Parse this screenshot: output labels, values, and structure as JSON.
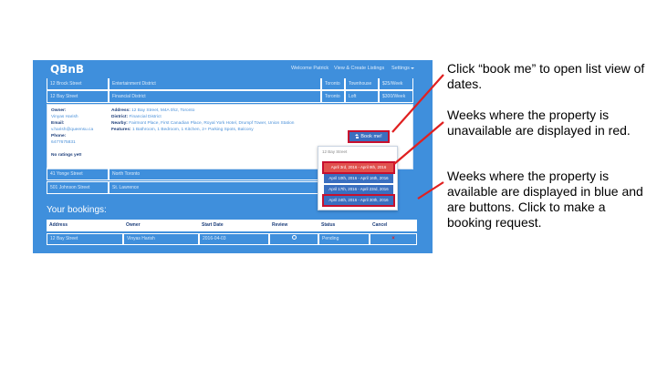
{
  "app": {
    "logo": "QBnB",
    "nav": {
      "welcome": "Welcome Patrick",
      "view_create": "View & Create Listings",
      "settings": "Settings"
    },
    "listings_top": [
      {
        "address": "12 Brock Street",
        "district": "Entertainment District",
        "city": "Toronto",
        "type": "Townhouse",
        "price": "$25/Week"
      },
      {
        "address": "12 Bay Street",
        "district": "Financial District",
        "city": "Toronto",
        "type": "Loft",
        "price": "$300/Week"
      }
    ],
    "detail": {
      "owner_label": "Owner:",
      "owner": "Vinyas Harish",
      "email_label": "Email:",
      "email": "v.harish@queensu.ca",
      "phone_label": "Phone:",
      "phone": "6477675831",
      "ratings": "No ratings yet!",
      "address_label": "Address:",
      "address": "12 Bay Street, M4A 0h2, Toronto",
      "district_label": "District:",
      "district": "Financial District",
      "nearby_label": "Nearby:",
      "nearby": "Fairmont Place, First Canadian Place, Royal York Hotel, Drumpf Tower, Union Station",
      "features_label": "Features:",
      "features": "1 Bathroom, 1 Bedroom, 1 Kitchen, 2+ Parking Spots, Balcony",
      "book_button": "Book me!"
    },
    "dropdown": {
      "title": "12 Bay Street",
      "weeks": [
        {
          "label": "April 3rd, 2016 - April 9th, 2016",
          "status": "unavailable"
        },
        {
          "label": "April 10th, 2016 - April 16th, 2016",
          "status": "available"
        },
        {
          "label": "April 17th, 2016 - April 23rd, 2016",
          "status": "available"
        },
        {
          "label": "April 24th, 2016 - April 30th, 2016",
          "status": "available"
        }
      ]
    },
    "listings_bottom": [
      {
        "address": "41 Yonge Street",
        "district": "North Toronto"
      },
      {
        "address": "501 Johnson Street",
        "district": "St. Lawrence"
      }
    ],
    "bookings": {
      "title": "Your bookings:",
      "headers": [
        "Address",
        "Owner",
        "Start Date",
        "Review",
        "Status",
        "Cancel"
      ],
      "rows": [
        {
          "address": "12 Bay Street",
          "owner": "Vinyas Harish",
          "start_date": "2016-04-03",
          "review_icon": "review-icon",
          "status": "Pending",
          "cancel_icon": "x-icon",
          "cancel": "×"
        }
      ]
    }
  },
  "annotations": [
    "Click “book me” to open list view of dates.",
    "Weeks where the property is unavailable are displayed in red.",
    "Weeks where the property is available are displayed in blue and are buttons. Click to make a booking request."
  ],
  "colors": {
    "primary": "#3f8fdc",
    "button": "#3a6fc0",
    "unavailable": "#e1514d",
    "highlight": "#c8102e"
  }
}
